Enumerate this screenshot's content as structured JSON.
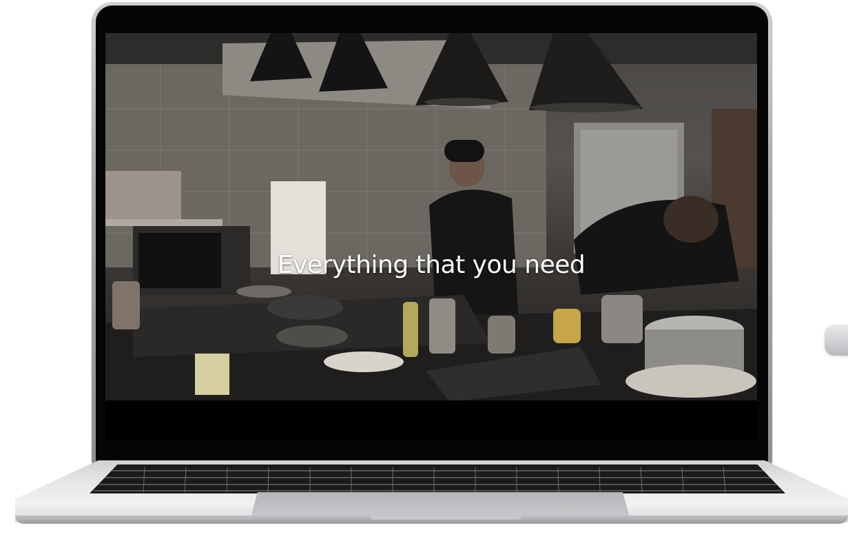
{
  "video": {
    "caption": "Everything that you need"
  },
  "colors": {
    "caption_text": "#ffffff",
    "bezel": "#050505",
    "chassis": "#cfd0d3",
    "keyboard": "#1a1a1b"
  }
}
